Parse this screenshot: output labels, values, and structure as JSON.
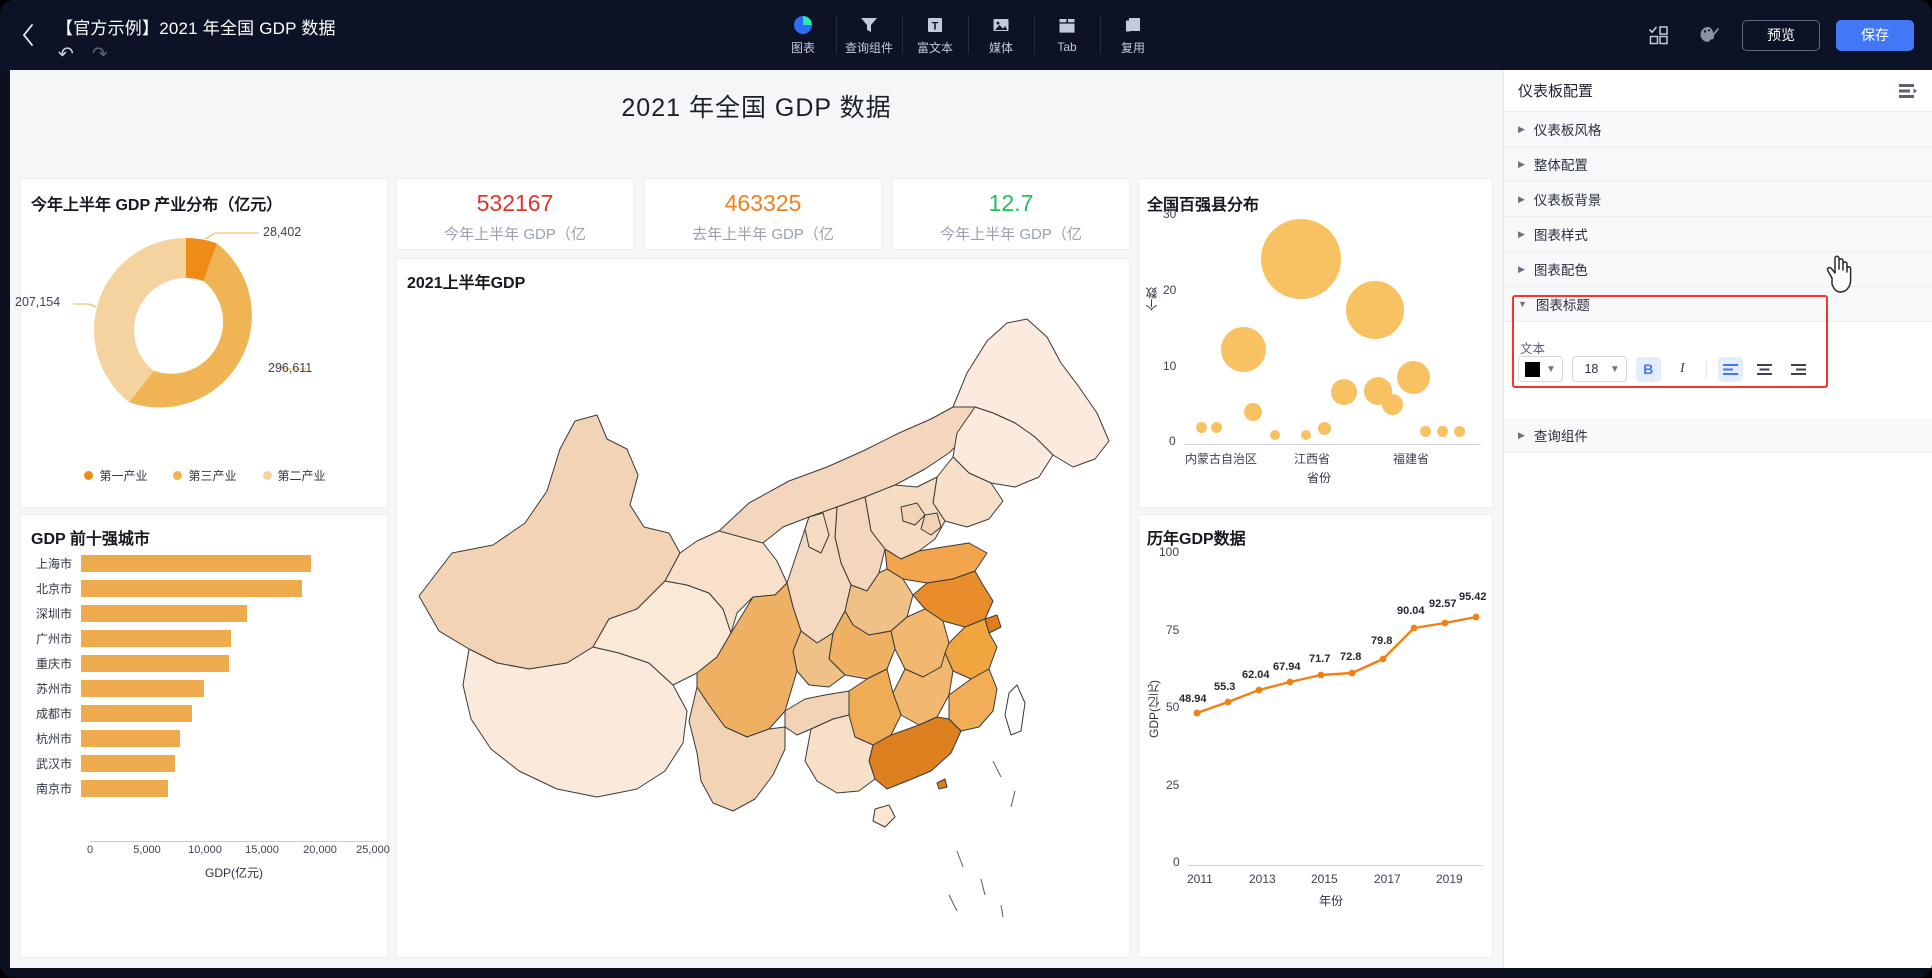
{
  "header": {
    "back_icon": "chevron-left-icon",
    "doc_title": "【官方示例】2021 年全国 GDP 数据",
    "undo_icon": "undo-icon",
    "redo_icon": "redo-icon",
    "tools": [
      {
        "label": "图表",
        "icon": "pie-chart-icon"
      },
      {
        "label": "查询组件",
        "icon": "filter-icon"
      },
      {
        "label": "富文本",
        "icon": "text-box-icon"
      },
      {
        "label": "媒体",
        "icon": "image-icon"
      },
      {
        "label": "Tab",
        "icon": "tab-icon"
      },
      {
        "label": "复用",
        "icon": "copy-icon"
      }
    ],
    "layout_icon": "layout-grid-icon",
    "theme_icon": "palette-icon",
    "preview_label": "预览",
    "save_label": "保存",
    "primary_color": "#4278f5"
  },
  "dashboard": {
    "title": "2021 年全国 GDP 数据",
    "kpis": [
      {
        "value": "532167",
        "caption": "今年上半年 GDP（亿",
        "color": "#e0342c"
      },
      {
        "value": "463325",
        "caption": "去年上半年 GDP（亿",
        "color": "#ef8019"
      },
      {
        "value": "12.7",
        "caption": "今年上半年 GDP（亿",
        "color": "#20c05a"
      }
    ]
  },
  "chart_data": [
    {
      "type": "pie",
      "id": "donut",
      "title": "今年上半年 GDP 产业分布（亿元）",
      "categories": [
        "第一产业",
        "第三产业",
        "第二产业"
      ],
      "values": [
        28402,
        296611,
        207154
      ],
      "labels": [
        "28,402",
        "296,611",
        "207,154"
      ],
      "colors": [
        "#ef8b17",
        "#f0b455",
        "#f5d39e"
      ],
      "legend_position": "bottom",
      "donut": true
    },
    {
      "type": "bar",
      "id": "top10-cities",
      "title": "GDP 前十强城市",
      "orientation": "horizontal",
      "categories": [
        "上海市",
        "北京市",
        "深圳市",
        "广州市",
        "重庆市",
        "苏州市",
        "成都市",
        "杭州市",
        "武汉市",
        "南京市"
      ],
      "values": [
        20000,
        19200,
        14400,
        13050,
        12850,
        10650,
        9650,
        8600,
        8200,
        7600
      ],
      "xlabel": "GDP(亿元)",
      "ylabel": "",
      "xlim": [
        0,
        25000
      ],
      "xticks": [
        "0",
        "5,000",
        "10,000",
        "15,000",
        "20,000",
        "25,000"
      ],
      "color": "#eeab4e",
      "grid": false
    },
    {
      "type": "scatter",
      "id": "top100-counties",
      "title": "全国百强县分布",
      "xlabel": "省份",
      "ylabel": "个数",
      "ylim": [
        0,
        30
      ],
      "yticks": [
        "0",
        "10",
        "20",
        "30"
      ],
      "xticks": [
        "内蒙古自治区",
        "江西省",
        "福建省"
      ],
      "color": "#f8c263",
      "points": [
        {
          "x": 0.04,
          "y": 1.6,
          "size": 11
        },
        {
          "x": 0.12,
          "y": 1.6,
          "size": 11
        },
        {
          "x": 0.2,
          "y": 14.0,
          "size": 45
        },
        {
          "x": 0.28,
          "y": 3.6,
          "size": 18
        },
        {
          "x": 0.32,
          "y": 25.5,
          "size": 80
        },
        {
          "x": 0.38,
          "y": 1.0,
          "size": 10
        },
        {
          "x": 0.48,
          "y": 1.0,
          "size": 10
        },
        {
          "x": 0.53,
          "y": 1.8,
          "size": 13
        },
        {
          "x": 0.58,
          "y": 6.3,
          "size": 26
        },
        {
          "x": 0.65,
          "y": 18.0,
          "size": 58
        },
        {
          "x": 0.69,
          "y": 6.4,
          "size": 28
        },
        {
          "x": 0.74,
          "y": 4.6,
          "size": 21
        },
        {
          "x": 0.79,
          "y": 8.6,
          "size": 33
        },
        {
          "x": 0.86,
          "y": 1.3,
          "size": 11
        },
        {
          "x": 0.91,
          "y": 1.3,
          "size": 11
        },
        {
          "x": 0.96,
          "y": 1.3,
          "size": 11
        }
      ]
    },
    {
      "type": "line",
      "id": "gdp-history",
      "title": "历年GDP数据",
      "xlabel": "年份",
      "ylabel": "GDP(亿元)",
      "x": [
        2011,
        2012,
        2013,
        2014,
        2015,
        2016,
        2017,
        2018,
        2019,
        2020
      ],
      "values": [
        48.94,
        55.3,
        62.04,
        67.94,
        71.7,
        72.8,
        79.8,
        90.04,
        92.57,
        95.42
      ],
      "point_labels": [
        "48.94",
        "55.3",
        "62.04",
        "67.94",
        "71.7",
        "72.8",
        "79.8",
        "90.04",
        "92.57",
        "95.42"
      ],
      "ylim": [
        0,
        100
      ],
      "yticks": [
        "0",
        "25",
        "50",
        "75",
        "100"
      ],
      "xticks": [
        "2011",
        "2013",
        "2015",
        "2017",
        "2019"
      ],
      "color": "#f08016",
      "grid": false
    },
    {
      "type": "map",
      "id": "china-gdp-map",
      "title": "2021上半年GDP",
      "region": "中国",
      "colorscale": [
        "#fcf0e5",
        "#d4792c"
      ]
    }
  ],
  "panel": {
    "header_title": "仪表板配置",
    "header_icon": "list-indent-icon",
    "sections": [
      {
        "label": "仪表板风格",
        "expanded": false
      },
      {
        "label": "整体配置",
        "expanded": false
      },
      {
        "label": "仪表板背景",
        "expanded": false
      },
      {
        "label": "图表样式",
        "expanded": false
      },
      {
        "label": "图表配色",
        "expanded": false
      },
      {
        "label": "图表标题",
        "expanded": true
      },
      {
        "label": "查询组件",
        "expanded": false
      }
    ],
    "title_section": {
      "text_label": "文本",
      "color_value": "#000000",
      "font_size": "18",
      "bold_label": "B",
      "bold_active": true,
      "italic_label": "I",
      "italic_active": false,
      "align_left_icon": "align-left-icon",
      "align_center_icon": "align-center-icon",
      "align_right_icon": "align-right-icon",
      "align_active": "left",
      "highlight_color": "#f5342b"
    }
  },
  "cursor": {
    "icon": "hand-pointer-cursor"
  }
}
